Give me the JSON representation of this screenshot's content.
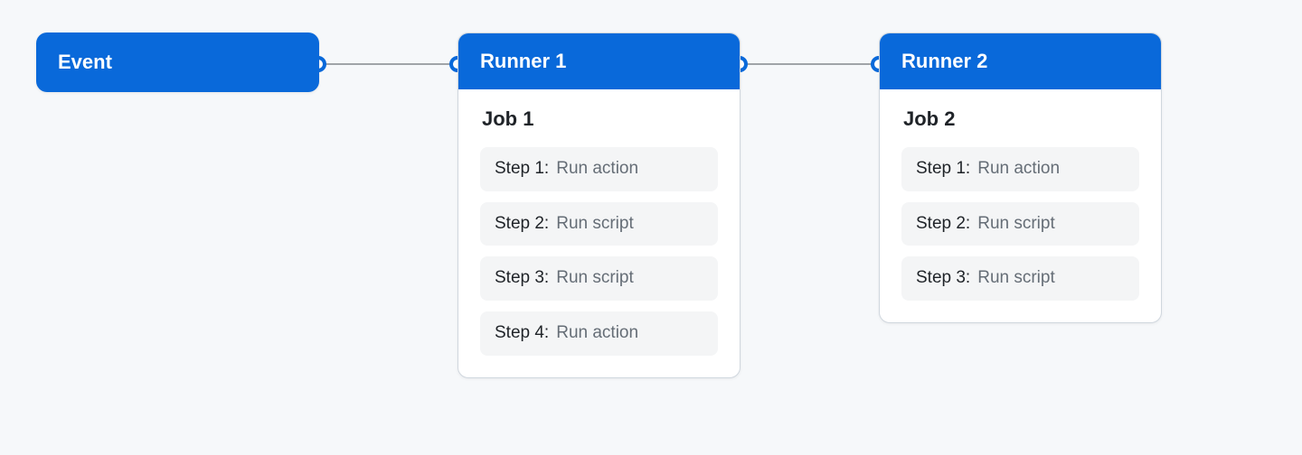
{
  "event": {
    "label": "Event"
  },
  "runners": [
    {
      "header": "Runner 1",
      "job_title": "Job 1",
      "steps": [
        {
          "label": "Step 1:",
          "action": "Run action"
        },
        {
          "label": "Step 2:",
          "action": "Run script"
        },
        {
          "label": "Step 3:",
          "action": "Run script"
        },
        {
          "label": "Step 4:",
          "action": "Run action"
        }
      ]
    },
    {
      "header": "Runner 2",
      "job_title": "Job 2",
      "steps": [
        {
          "label": "Step 1:",
          "action": "Run action"
        },
        {
          "label": "Step 2:",
          "action": "Run script"
        },
        {
          "label": "Step 3:",
          "action": "Run script"
        }
      ]
    }
  ]
}
